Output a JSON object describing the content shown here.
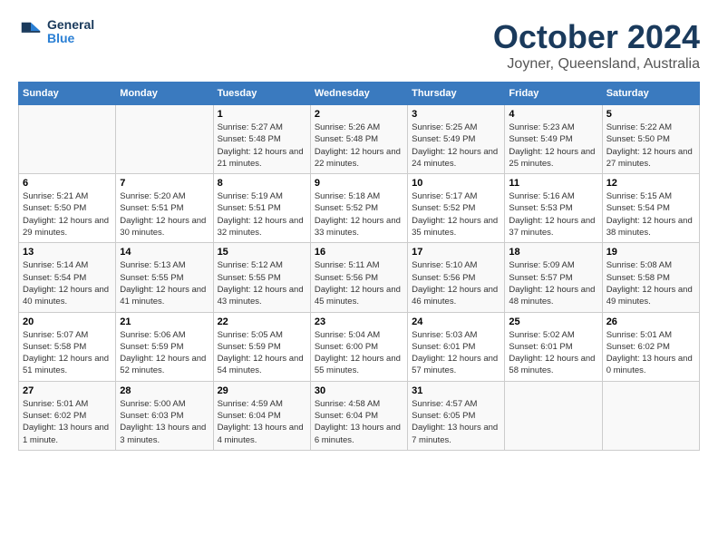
{
  "header": {
    "logo_line1": "General",
    "logo_line2": "Blue",
    "month": "October 2024",
    "location": "Joyner, Queensland, Australia"
  },
  "weekdays": [
    "Sunday",
    "Monday",
    "Tuesday",
    "Wednesday",
    "Thursday",
    "Friday",
    "Saturday"
  ],
  "weeks": [
    [
      {
        "day": "",
        "sunrise": "",
        "sunset": "",
        "daylight": "",
        "empty": true
      },
      {
        "day": "",
        "sunrise": "",
        "sunset": "",
        "daylight": "",
        "empty": true
      },
      {
        "day": "1",
        "sunrise": "Sunrise: 5:27 AM",
        "sunset": "Sunset: 5:48 PM",
        "daylight": "Daylight: 12 hours and 21 minutes."
      },
      {
        "day": "2",
        "sunrise": "Sunrise: 5:26 AM",
        "sunset": "Sunset: 5:48 PM",
        "daylight": "Daylight: 12 hours and 22 minutes."
      },
      {
        "day": "3",
        "sunrise": "Sunrise: 5:25 AM",
        "sunset": "Sunset: 5:49 PM",
        "daylight": "Daylight: 12 hours and 24 minutes."
      },
      {
        "day": "4",
        "sunrise": "Sunrise: 5:23 AM",
        "sunset": "Sunset: 5:49 PM",
        "daylight": "Daylight: 12 hours and 25 minutes."
      },
      {
        "day": "5",
        "sunrise": "Sunrise: 5:22 AM",
        "sunset": "Sunset: 5:50 PM",
        "daylight": "Daylight: 12 hours and 27 minutes."
      }
    ],
    [
      {
        "day": "6",
        "sunrise": "Sunrise: 5:21 AM",
        "sunset": "Sunset: 5:50 PM",
        "daylight": "Daylight: 12 hours and 29 minutes."
      },
      {
        "day": "7",
        "sunrise": "Sunrise: 5:20 AM",
        "sunset": "Sunset: 5:51 PM",
        "daylight": "Daylight: 12 hours and 30 minutes."
      },
      {
        "day": "8",
        "sunrise": "Sunrise: 5:19 AM",
        "sunset": "Sunset: 5:51 PM",
        "daylight": "Daylight: 12 hours and 32 minutes."
      },
      {
        "day": "9",
        "sunrise": "Sunrise: 5:18 AM",
        "sunset": "Sunset: 5:52 PM",
        "daylight": "Daylight: 12 hours and 33 minutes."
      },
      {
        "day": "10",
        "sunrise": "Sunrise: 5:17 AM",
        "sunset": "Sunset: 5:52 PM",
        "daylight": "Daylight: 12 hours and 35 minutes."
      },
      {
        "day": "11",
        "sunrise": "Sunrise: 5:16 AM",
        "sunset": "Sunset: 5:53 PM",
        "daylight": "Daylight: 12 hours and 37 minutes."
      },
      {
        "day": "12",
        "sunrise": "Sunrise: 5:15 AM",
        "sunset": "Sunset: 5:54 PM",
        "daylight": "Daylight: 12 hours and 38 minutes."
      }
    ],
    [
      {
        "day": "13",
        "sunrise": "Sunrise: 5:14 AM",
        "sunset": "Sunset: 5:54 PM",
        "daylight": "Daylight: 12 hours and 40 minutes."
      },
      {
        "day": "14",
        "sunrise": "Sunrise: 5:13 AM",
        "sunset": "Sunset: 5:55 PM",
        "daylight": "Daylight: 12 hours and 41 minutes."
      },
      {
        "day": "15",
        "sunrise": "Sunrise: 5:12 AM",
        "sunset": "Sunset: 5:55 PM",
        "daylight": "Daylight: 12 hours and 43 minutes."
      },
      {
        "day": "16",
        "sunrise": "Sunrise: 5:11 AM",
        "sunset": "Sunset: 5:56 PM",
        "daylight": "Daylight: 12 hours and 45 minutes."
      },
      {
        "day": "17",
        "sunrise": "Sunrise: 5:10 AM",
        "sunset": "Sunset: 5:56 PM",
        "daylight": "Daylight: 12 hours and 46 minutes."
      },
      {
        "day": "18",
        "sunrise": "Sunrise: 5:09 AM",
        "sunset": "Sunset: 5:57 PM",
        "daylight": "Daylight: 12 hours and 48 minutes."
      },
      {
        "day": "19",
        "sunrise": "Sunrise: 5:08 AM",
        "sunset": "Sunset: 5:58 PM",
        "daylight": "Daylight: 12 hours and 49 minutes."
      }
    ],
    [
      {
        "day": "20",
        "sunrise": "Sunrise: 5:07 AM",
        "sunset": "Sunset: 5:58 PM",
        "daylight": "Daylight: 12 hours and 51 minutes."
      },
      {
        "day": "21",
        "sunrise": "Sunrise: 5:06 AM",
        "sunset": "Sunset: 5:59 PM",
        "daylight": "Daylight: 12 hours and 52 minutes."
      },
      {
        "day": "22",
        "sunrise": "Sunrise: 5:05 AM",
        "sunset": "Sunset: 5:59 PM",
        "daylight": "Daylight: 12 hours and 54 minutes."
      },
      {
        "day": "23",
        "sunrise": "Sunrise: 5:04 AM",
        "sunset": "Sunset: 6:00 PM",
        "daylight": "Daylight: 12 hours and 55 minutes."
      },
      {
        "day": "24",
        "sunrise": "Sunrise: 5:03 AM",
        "sunset": "Sunset: 6:01 PM",
        "daylight": "Daylight: 12 hours and 57 minutes."
      },
      {
        "day": "25",
        "sunrise": "Sunrise: 5:02 AM",
        "sunset": "Sunset: 6:01 PM",
        "daylight": "Daylight: 12 hours and 58 minutes."
      },
      {
        "day": "26",
        "sunrise": "Sunrise: 5:01 AM",
        "sunset": "Sunset: 6:02 PM",
        "daylight": "Daylight: 13 hours and 0 minutes."
      }
    ],
    [
      {
        "day": "27",
        "sunrise": "Sunrise: 5:01 AM",
        "sunset": "Sunset: 6:02 PM",
        "daylight": "Daylight: 13 hours and 1 minute."
      },
      {
        "day": "28",
        "sunrise": "Sunrise: 5:00 AM",
        "sunset": "Sunset: 6:03 PM",
        "daylight": "Daylight: 13 hours and 3 minutes."
      },
      {
        "day": "29",
        "sunrise": "Sunrise: 4:59 AM",
        "sunset": "Sunset: 6:04 PM",
        "daylight": "Daylight: 13 hours and 4 minutes."
      },
      {
        "day": "30",
        "sunrise": "Sunrise: 4:58 AM",
        "sunset": "Sunset: 6:04 PM",
        "daylight": "Daylight: 13 hours and 6 minutes."
      },
      {
        "day": "31",
        "sunrise": "Sunrise: 4:57 AM",
        "sunset": "Sunset: 6:05 PM",
        "daylight": "Daylight: 13 hours and 7 minutes."
      },
      {
        "day": "",
        "sunrise": "",
        "sunset": "",
        "daylight": "",
        "empty": true
      },
      {
        "day": "",
        "sunrise": "",
        "sunset": "",
        "daylight": "",
        "empty": true
      }
    ]
  ]
}
